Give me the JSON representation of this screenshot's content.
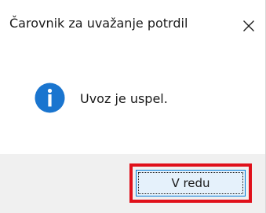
{
  "dialog": {
    "title": "Čarovnik za uvažanje potrdil",
    "close_icon": "close-icon",
    "message": "Uvoz je uspel.",
    "message_icon": "info-icon",
    "ok_label": "V redu"
  },
  "colors": {
    "info_icon_blue": "#1a75cf",
    "button_border": "#0078d7",
    "button_fill": "#e5f1fb",
    "highlight_red": "#e0101a",
    "footer_gray": "#f0f0f0"
  }
}
